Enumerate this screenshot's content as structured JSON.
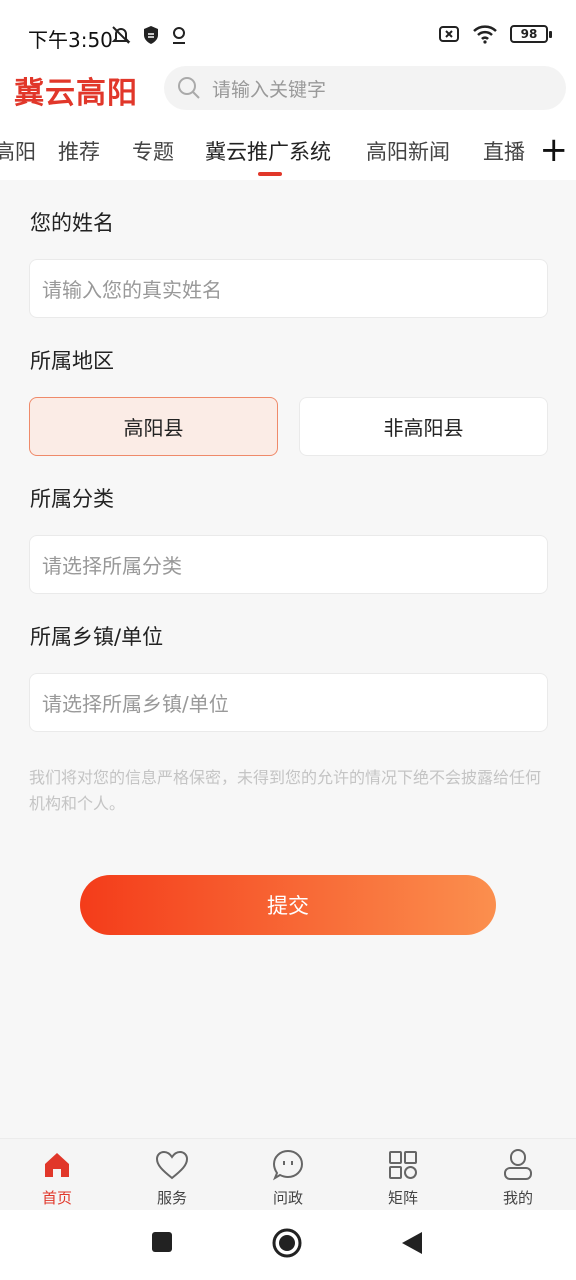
{
  "status": {
    "time": "下午3:50",
    "battery": "98"
  },
  "header": {
    "logo": "冀云高阳",
    "search_placeholder": "请输入关键字"
  },
  "tabs": [
    {
      "label": "高阳"
    },
    {
      "label": "推荐"
    },
    {
      "label": "专题"
    },
    {
      "label": "冀云推广系统"
    },
    {
      "label": "高阳新闻"
    },
    {
      "label": "直播"
    }
  ],
  "form": {
    "name_label": "您的姓名",
    "name_placeholder": "请输入您的真实姓名",
    "region_label": "所属地区",
    "region_options": [
      "高阳县",
      "非高阳县"
    ],
    "region_selected": "高阳县",
    "category_label": "所属分类",
    "category_placeholder": "请选择所属分类",
    "town_label": "所属乡镇/单位",
    "town_placeholder": "请选择所属乡镇/单位",
    "privacy_note": "我们将对您的信息严格保密，未得到您的允许的情况下绝不会披露给任何机构和个人。",
    "submit_label": "提交"
  },
  "tabbar": [
    {
      "label": "首页",
      "icon": "home-icon",
      "active": true
    },
    {
      "label": "服务",
      "icon": "heart-icon",
      "active": false
    },
    {
      "label": "问政",
      "icon": "chat-icon",
      "active": false
    },
    {
      "label": "矩阵",
      "icon": "grid-icon",
      "active": false
    },
    {
      "label": "我的",
      "icon": "user-icon",
      "active": false
    }
  ],
  "colors": {
    "accent": "#e1372a",
    "submit_gradient_start": "#f43c1a",
    "submit_gradient_end": "#fb8f4e"
  }
}
